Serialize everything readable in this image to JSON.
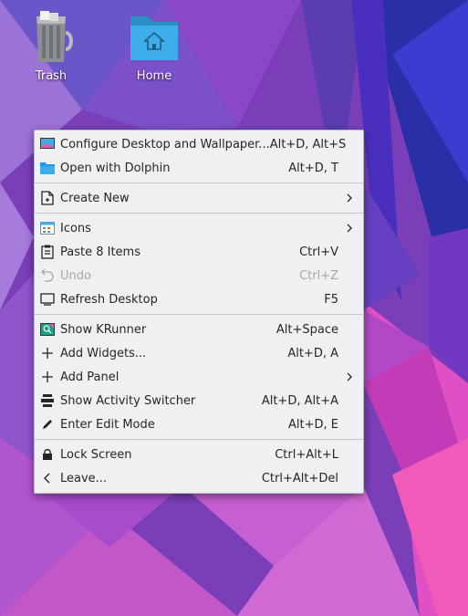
{
  "desktop": {
    "icons": [
      {
        "label": "Trash",
        "icon": "trash-icon"
      },
      {
        "label": "Home",
        "icon": "home-folder-icon"
      }
    ],
    "colors": {
      "wallpaper_base": "#7a3fb8",
      "wallpaper_accent": "#d64fc8",
      "folder_blue": "#3daee9"
    }
  },
  "menu": {
    "colors": {
      "background": "#eff0f1",
      "text": "#232629",
      "disabled": "#a4a7aa"
    },
    "items": [
      {
        "label": "Configure Desktop and Wallpaper...",
        "shortcut": "Alt+D, Alt+S",
        "icon": "configure-desktop-icon"
      },
      {
        "label": "Open with Dolphin",
        "shortcut": "Alt+D, T",
        "icon": "folder-icon"
      },
      {
        "label": "Create New",
        "icon": "new-document-icon",
        "submenu": true
      },
      {
        "label": "Icons",
        "icon": "icons-view-icon",
        "submenu": true
      },
      {
        "label": "Paste 8 Items",
        "shortcut": "Ctrl+V",
        "icon": "clipboard-icon"
      },
      {
        "label": "Undo",
        "shortcut": "Ctrl+Z",
        "icon": "undo-icon",
        "disabled": true
      },
      {
        "label": "Refresh Desktop",
        "shortcut": "F5",
        "icon": "monitor-icon"
      },
      {
        "label": "Show KRunner",
        "shortcut": "Alt+Space",
        "icon": "krunner-icon"
      },
      {
        "label": "Add Widgets...",
        "shortcut": "Alt+D, A",
        "icon": "plus-icon"
      },
      {
        "label": "Add Panel",
        "icon": "plus-icon",
        "submenu": true
      },
      {
        "label": "Show Activity Switcher",
        "shortcut": "Alt+D, Alt+A",
        "icon": "activities-icon"
      },
      {
        "label": "Enter Edit Mode",
        "shortcut": "Alt+D, E",
        "icon": "pencil-icon"
      },
      {
        "label": "Lock Screen",
        "shortcut": "Ctrl+Alt+L",
        "icon": "lock-icon"
      },
      {
        "label": "Leave...",
        "shortcut": "Ctrl+Alt+Del",
        "icon": "chevron-left-icon"
      }
    ]
  }
}
